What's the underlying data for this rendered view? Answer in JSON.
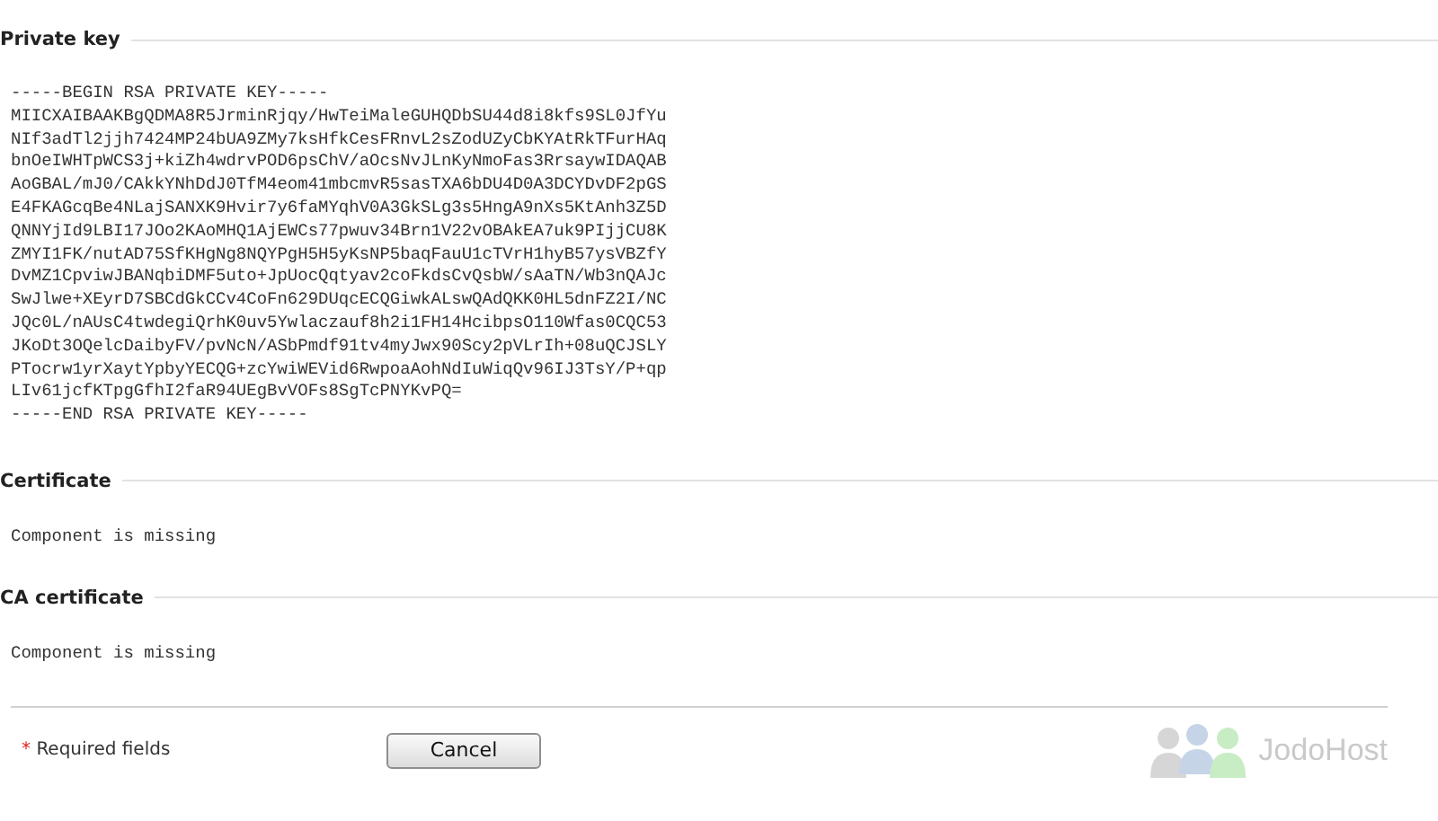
{
  "sections": [
    {
      "title": "Private key",
      "kind": "key",
      "lines": [
        "-----BEGIN RSA PRIVATE KEY-----",
        "MIICXAIBAAKBgQDMA8R5JrminRjqy/HwTeiMaleGUHQDbSU44d8i8kfs9SL0JfYu",
        "NIf3adTl2jjh7424MP24bUA9ZMy7ksHfkCesFRnvL2sZodUZyCbKYAtRkTFurHAq",
        "bnOeIWHTpWCS3j+kiZh4wdrvPOD6psChV/aOcsNvJLnKyNmoFas3RrsaywIDAQAB",
        "AoGBAL/mJ0/CAkkYNhDdJ0TfM4eom41mbcmvR5sasTXA6bDU4D0A3DCYDvDF2pGS",
        "E4FKAGcqBe4NLajSANXK9Hvir7y6faMYqhV0A3GkSLg3s5HngA9nXs5KtAnh3Z5D",
        "QNNYjId9LBI17JOo2KAoMHQ1AjEWCs77pwuv34Brn1V22vOBAkEA7uk9PIjjCU8K",
        "ZMYI1FK/nutAD75SfKHgNg8NQYPgH5H5yKsNP5baqFauU1cTVrH1hyB57ysVBZfY",
        "DvMZ1CpviwJBANqbiDMF5uto+JpUocQqtyav2coFkdsCvQsbW/sAaTN/Wb3nQAJc",
        "SwJlwe+XEyrD7SBCdGkCCv4CoFn629DUqcECQGiwkALswQAdQKK0HL5dnFZ2I/NC",
        "JQc0L/nAUsC4twdegiQrhK0uv5Ywlaczauf8h2i1FH14HcibpsO110Wfas0CQC53",
        "JKoDt3OQelcDaibyFV/pvNcN/ASbPmdf91tv4myJwx90Scy2pVLrIh+08uQCJSLY",
        "PTocrw1yrXaytYpbyYECQG+zcYwiWEVid6RwpoaAohNdIuWiqQv96IJ3TsY/P+qp",
        "LIv61jcfKTpgGfhI2faR94UEgBvVOFs8SgTcPNYKvPQ=",
        "-----END RSA PRIVATE KEY-----"
      ]
    },
    {
      "title": "Certificate",
      "kind": "missing",
      "message": "Component is missing"
    },
    {
      "title": "CA certificate",
      "kind": "missing",
      "message": "Component is missing"
    }
  ],
  "footer": {
    "required_mark": "*",
    "required_label": "Required fields",
    "cancel_button": "Cancel",
    "logo_text": "JodoHost"
  }
}
